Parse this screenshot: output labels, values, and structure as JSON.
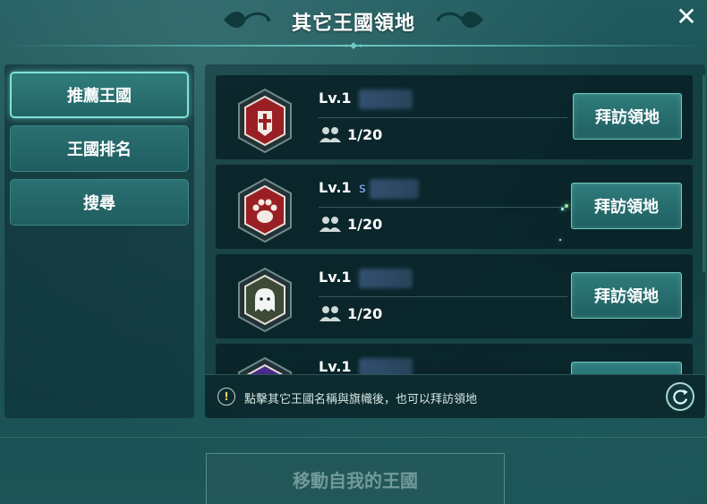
{
  "header": {
    "title": "其它王國領地",
    "close_label": "✕"
  },
  "sidebar": {
    "items": [
      {
        "label": "推薦王國",
        "active": true
      },
      {
        "label": "王國排名",
        "active": false
      },
      {
        "label": "搜尋",
        "active": false
      }
    ]
  },
  "kingdoms": [
    {
      "level": "Lv.1",
      "name_visible": "",
      "members": "1/20",
      "visit_label": "拜訪領地",
      "emblem": "shield-cross-icon",
      "emblem_color": "#9a1f25"
    },
    {
      "level": "Lv.1",
      "name_visible": "s",
      "members": "1/20",
      "visit_label": "拜訪領地",
      "emblem": "paw-icon",
      "emblem_color": "#9a1f25"
    },
    {
      "level": "Lv.1",
      "name_visible": "",
      "members": "1/20",
      "visit_label": "拜訪領地",
      "emblem": "ghost-icon",
      "emblem_color": "#3d4a35"
    },
    {
      "level": "Lv.1",
      "name_visible": "",
      "members": "",
      "visit_label": "",
      "emblem": "dragon-icon",
      "emblem_color": "#4a2a8a"
    }
  ],
  "hint": {
    "icon": "!",
    "text": "點擊其它王國名稱與旗幟後，也可以拜訪領地"
  },
  "footer": {
    "move_label": "移動自我的王國"
  },
  "colors": {
    "accent": "#7fe3d6",
    "panel": "#1a4d51"
  }
}
